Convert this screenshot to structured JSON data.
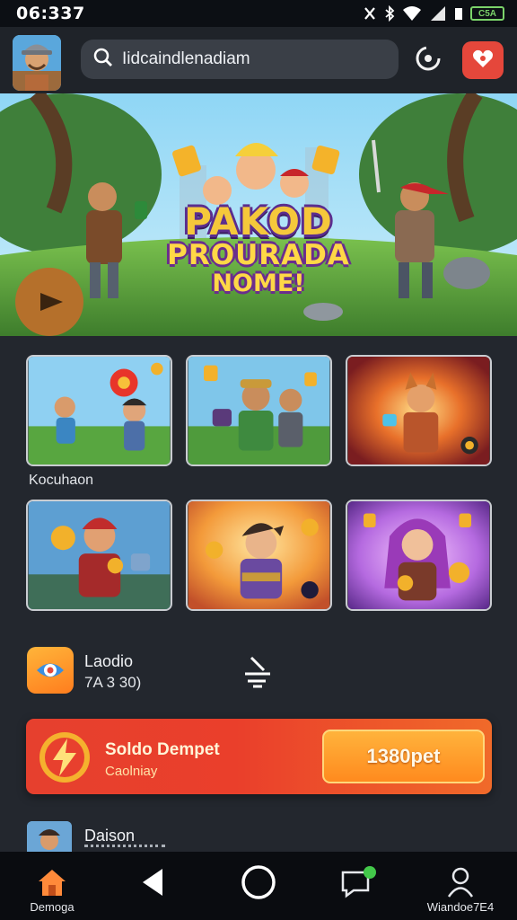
{
  "status_bar": {
    "time": "06:337",
    "battery": "C5A"
  },
  "header": {
    "search_text": "Iidcaindlenadiam"
  },
  "hero": {
    "title_line1": "PAKOD",
    "title_line2": "PROURADA",
    "title_line3": "NOME!"
  },
  "section_label": "Kocuhaon",
  "promo": {
    "title": "Laodio",
    "subtitle": "7A 3 30)"
  },
  "deposit": {
    "title": "Soldo Dempet",
    "subtitle": "Caolniay",
    "button": "1380pet"
  },
  "bottom_item": {
    "title": "Daison"
  },
  "nav": {
    "home_label": "Demoga",
    "profile_label": "Wiandoe7E4"
  },
  "colors": {
    "accent_red": "#e5473b",
    "accent_orange": "#ff8a1e",
    "app_bg": "#23272e",
    "icon_green": "#43c84a"
  },
  "icons": [
    "search-icon",
    "spinner-icon",
    "gift-icon",
    "promo-eye-icon",
    "lightning-coin-icon",
    "home-icon",
    "back-icon",
    "home-circle-icon",
    "chat-icon",
    "profile-icon"
  ]
}
